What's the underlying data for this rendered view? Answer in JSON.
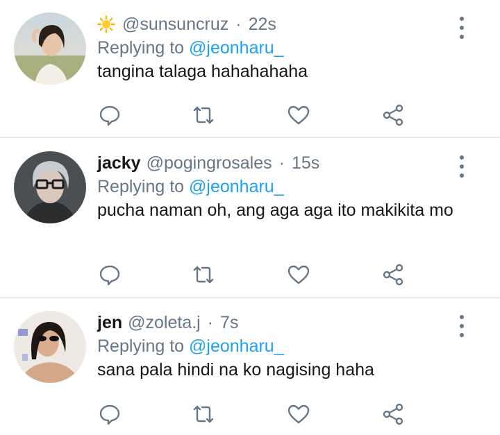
{
  "tweets": [
    {
      "name": "",
      "name_icon": "sun-emoji-icon",
      "handle": "@sunsuncruz",
      "separator": "·",
      "time": "22s",
      "replying_prefix": "Replying to",
      "replying_to": "@jeonharu_",
      "text": "tangina talaga hahahahaha"
    },
    {
      "name": "jacky",
      "handle": "@pogingrosales",
      "separator": "·",
      "time": "15s",
      "replying_prefix": "Replying to",
      "replying_to": "@jeonharu_",
      "text": "pucha naman oh, ang aga aga ito makikita mo"
    },
    {
      "name": "jen",
      "handle": "@zoleta.j",
      "separator": "·",
      "time": "7s",
      "replying_prefix": "Replying to",
      "replying_to": "@jeonharu_",
      "text": "sana pala hindi na ko nagising haha"
    }
  ],
  "action_icons": [
    "reply-icon",
    "retweet-icon",
    "like-icon",
    "share-icon"
  ],
  "colors": {
    "text": "#14171a",
    "muted": "#657786",
    "link": "#1da1f2",
    "divider": "#e6ecf0",
    "icon": "#657786"
  }
}
